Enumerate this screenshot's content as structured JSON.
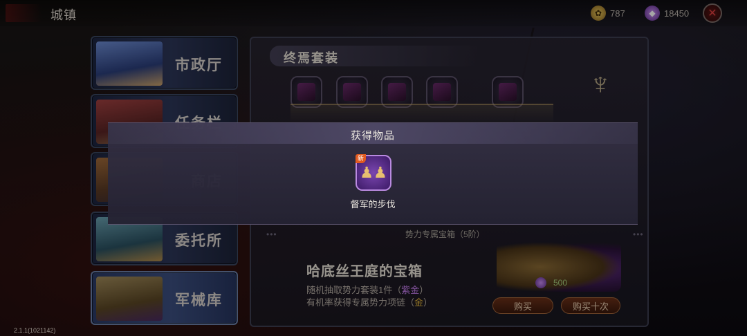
{
  "header": {
    "title": "城镇",
    "gold": "787",
    "gems": "18450"
  },
  "sidebar": {
    "items": [
      {
        "label": "市政厅"
      },
      {
        "label": "任务栏"
      },
      {
        "label": "商店"
      },
      {
        "label": "委托所"
      },
      {
        "label": "军械库"
      }
    ]
  },
  "set_panel": {
    "title": "终焉套装"
  },
  "chest": {
    "tier_label": "势力专属宝箱（5阶）",
    "name": "哈底丝王庭的宝箱",
    "desc1_prefix": "随机抽取势力套装1件（",
    "desc1_highlight": "紫金",
    "desc1_suffix": "）",
    "desc2_prefix": "有机率获得专属势力项链（",
    "desc2_highlight": "金",
    "desc2_suffix": "）",
    "price": "500",
    "buy_label": "购买",
    "buy_ten_label": "购买十次"
  },
  "popup": {
    "title": "获得物品",
    "new_badge": "新",
    "item_name": "督军的步伐"
  },
  "footer": {
    "version": "2.1.1(1021142)"
  },
  "icons": {
    "gold": "gold-coin-icon",
    "gem": "purple-gem-icon",
    "close": "close-icon",
    "emblem": "phoenix-emblem-icon"
  },
  "colors": {
    "highlight_purple": "#c77ef0",
    "highlight_gold": "#e6b83c",
    "close_red": "#e04040"
  }
}
